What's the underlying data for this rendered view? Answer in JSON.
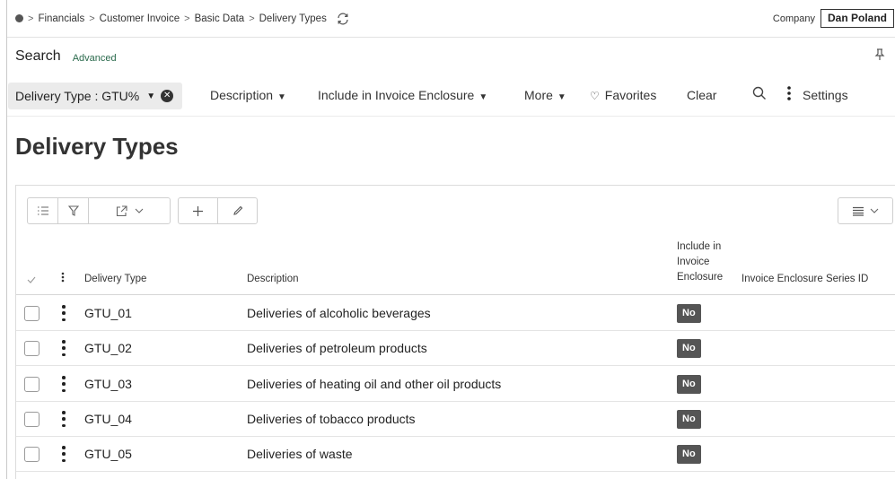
{
  "breadcrumb": {
    "items": [
      "Financials",
      "Customer Invoice",
      "Basic Data",
      "Delivery Types"
    ]
  },
  "company": {
    "label": "Company",
    "value": "Dan Poland"
  },
  "search": {
    "title": "Search",
    "advanced_label": "Advanced"
  },
  "filters": {
    "chip_label": "Delivery Type : GTU%",
    "description": "Description",
    "include_invoice_enclosure": "Include in Invoice Enclosure",
    "more": "More",
    "favorites": "Favorites",
    "clear": "Clear",
    "settings": "Settings"
  },
  "page": {
    "title": "Delivery Types"
  },
  "table": {
    "columns": {
      "delivery_type": "Delivery Type",
      "description": "Description",
      "include_line1": "Include in",
      "include_line2": "Invoice",
      "include_line3": "Enclosure",
      "series_id": "Invoice Enclosure Series ID"
    },
    "rows": [
      {
        "delivery_type": "GTU_01",
        "description": "Deliveries of alcoholic beverages",
        "include": "No"
      },
      {
        "delivery_type": "GTU_02",
        "description": "Deliveries of petroleum products",
        "include": "No"
      },
      {
        "delivery_type": "GTU_03",
        "description": "Deliveries of heating oil and other oil products",
        "include": "No"
      },
      {
        "delivery_type": "GTU_04",
        "description": "Deliveries of tobacco products",
        "include": "No"
      },
      {
        "delivery_type": "GTU_05",
        "description": "Deliveries of waste",
        "include": "No"
      }
    ]
  },
  "icons": {
    "home": "home-dot-icon",
    "refresh": "refresh-icon",
    "pin": "pin-icon",
    "search": "search-icon",
    "favorites": "heart-icon",
    "more": "kebab-icon"
  },
  "colors": {
    "badge_bg": "#555555",
    "advanced_link": "#2a6a4c",
    "chip_bg": "#ebebeb"
  }
}
